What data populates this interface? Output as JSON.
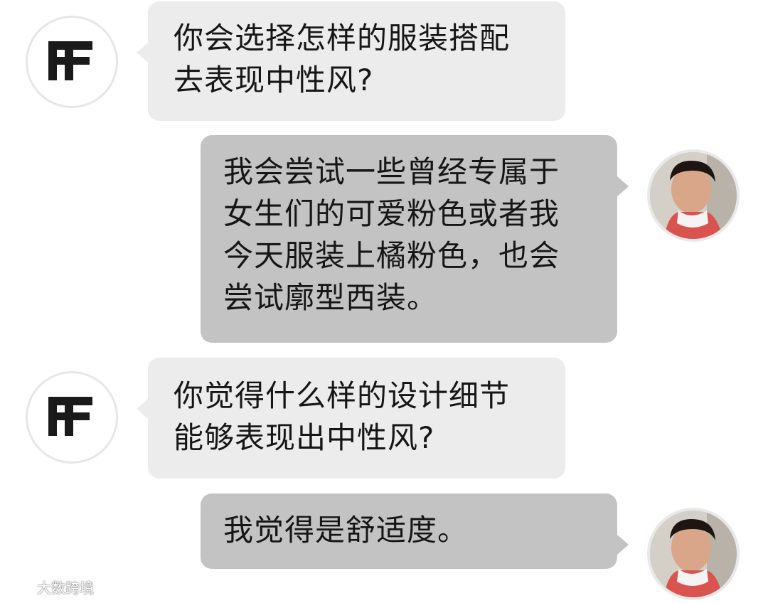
{
  "messages": [
    {
      "sender": "interviewer",
      "avatar_icon": "ff-logo-icon",
      "lines": [
        "你会选择怎样的服装搭配",
        "去表现中性风?"
      ]
    },
    {
      "sender": "guest",
      "avatar_icon": "person-avatar",
      "lines": [
        "我会尝试一些曾经专属于",
        "女生们的可爱粉色或者我",
        "今天服装上橘粉色，也会",
        "尝试廓型西装。"
      ]
    },
    {
      "sender": "interviewer",
      "avatar_icon": "ff-logo-icon",
      "lines": [
        "你觉得什么样的设计细节",
        "能够表现出中性风?"
      ]
    },
    {
      "sender": "guest",
      "avatar_icon": "person-avatar",
      "lines": [
        "我觉得是舒适度。"
      ]
    }
  ],
  "watermark": {
    "text": "大数跨境",
    "icon": "weibo-logo-icon"
  },
  "colors": {
    "left_bubble": "#ececec",
    "right_bubble": "#c3c3c3",
    "text": "#161616",
    "background": "#ffffff"
  }
}
